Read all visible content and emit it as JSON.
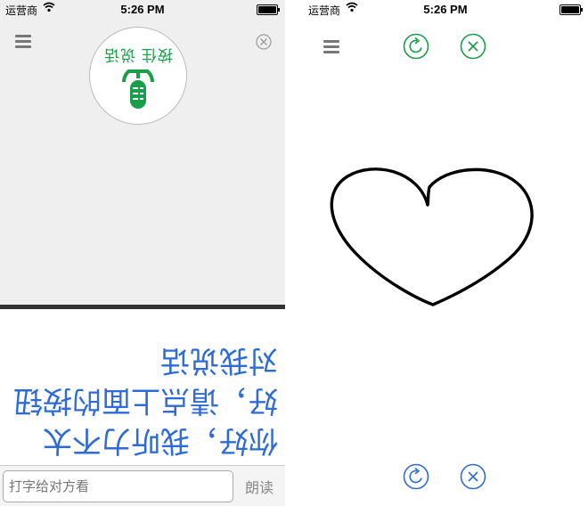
{
  "status_bar": {
    "carrier": "运营商",
    "time": "5:26 PM"
  },
  "left_screen": {
    "mic_button_label": "按住 说话",
    "flipped_message": "你好，我听力不太好，请点上面的按钮对我说话",
    "text_input_placeholder": "打字给对方看",
    "read_button_label": "朗读"
  },
  "colors": {
    "accent_green": "#1a9e4a",
    "accent_blue": "#2e6bd6",
    "panel_grey": "#efefef"
  },
  "icons": [
    "menu-icon",
    "close-icon",
    "microphone-icon",
    "refresh-icon",
    "wifi-icon",
    "battery-icon"
  ]
}
